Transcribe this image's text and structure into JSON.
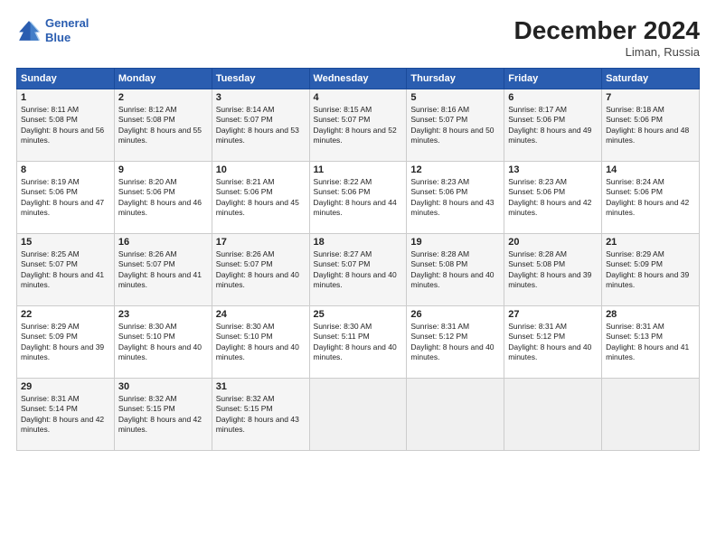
{
  "logo": {
    "line1": "General",
    "line2": "Blue"
  },
  "title": "December 2024",
  "location": "Liman, Russia",
  "days_of_week": [
    "Sunday",
    "Monday",
    "Tuesday",
    "Wednesday",
    "Thursday",
    "Friday",
    "Saturday"
  ],
  "weeks": [
    [
      {
        "day": "1",
        "sunrise": "8:11 AM",
        "sunset": "5:08 PM",
        "daylight": "8 hours and 56 minutes."
      },
      {
        "day": "2",
        "sunrise": "8:12 AM",
        "sunset": "5:08 PM",
        "daylight": "8 hours and 55 minutes."
      },
      {
        "day": "3",
        "sunrise": "8:14 AM",
        "sunset": "5:07 PM",
        "daylight": "8 hours and 53 minutes."
      },
      {
        "day": "4",
        "sunrise": "8:15 AM",
        "sunset": "5:07 PM",
        "daylight": "8 hours and 52 minutes."
      },
      {
        "day": "5",
        "sunrise": "8:16 AM",
        "sunset": "5:07 PM",
        "daylight": "8 hours and 50 minutes."
      },
      {
        "day": "6",
        "sunrise": "8:17 AM",
        "sunset": "5:06 PM",
        "daylight": "8 hours and 49 minutes."
      },
      {
        "day": "7",
        "sunrise": "8:18 AM",
        "sunset": "5:06 PM",
        "daylight": "8 hours and 48 minutes."
      }
    ],
    [
      {
        "day": "8",
        "sunrise": "8:19 AM",
        "sunset": "5:06 PM",
        "daylight": "8 hours and 47 minutes."
      },
      {
        "day": "9",
        "sunrise": "8:20 AM",
        "sunset": "5:06 PM",
        "daylight": "8 hours and 46 minutes."
      },
      {
        "day": "10",
        "sunrise": "8:21 AM",
        "sunset": "5:06 PM",
        "daylight": "8 hours and 45 minutes."
      },
      {
        "day": "11",
        "sunrise": "8:22 AM",
        "sunset": "5:06 PM",
        "daylight": "8 hours and 44 minutes."
      },
      {
        "day": "12",
        "sunrise": "8:23 AM",
        "sunset": "5:06 PM",
        "daylight": "8 hours and 43 minutes."
      },
      {
        "day": "13",
        "sunrise": "8:23 AM",
        "sunset": "5:06 PM",
        "daylight": "8 hours and 42 minutes."
      },
      {
        "day": "14",
        "sunrise": "8:24 AM",
        "sunset": "5:06 PM",
        "daylight": "8 hours and 42 minutes."
      }
    ],
    [
      {
        "day": "15",
        "sunrise": "8:25 AM",
        "sunset": "5:07 PM",
        "daylight": "8 hours and 41 minutes."
      },
      {
        "day": "16",
        "sunrise": "8:26 AM",
        "sunset": "5:07 PM",
        "daylight": "8 hours and 41 minutes."
      },
      {
        "day": "17",
        "sunrise": "8:26 AM",
        "sunset": "5:07 PM",
        "daylight": "8 hours and 40 minutes."
      },
      {
        "day": "18",
        "sunrise": "8:27 AM",
        "sunset": "5:07 PM",
        "daylight": "8 hours and 40 minutes."
      },
      {
        "day": "19",
        "sunrise": "8:28 AM",
        "sunset": "5:08 PM",
        "daylight": "8 hours and 40 minutes."
      },
      {
        "day": "20",
        "sunrise": "8:28 AM",
        "sunset": "5:08 PM",
        "daylight": "8 hours and 39 minutes."
      },
      {
        "day": "21",
        "sunrise": "8:29 AM",
        "sunset": "5:09 PM",
        "daylight": "8 hours and 39 minutes."
      }
    ],
    [
      {
        "day": "22",
        "sunrise": "8:29 AM",
        "sunset": "5:09 PM",
        "daylight": "8 hours and 39 minutes."
      },
      {
        "day": "23",
        "sunrise": "8:30 AM",
        "sunset": "5:10 PM",
        "daylight": "8 hours and 40 minutes."
      },
      {
        "day": "24",
        "sunrise": "8:30 AM",
        "sunset": "5:10 PM",
        "daylight": "8 hours and 40 minutes."
      },
      {
        "day": "25",
        "sunrise": "8:30 AM",
        "sunset": "5:11 PM",
        "daylight": "8 hours and 40 minutes."
      },
      {
        "day": "26",
        "sunrise": "8:31 AM",
        "sunset": "5:12 PM",
        "daylight": "8 hours and 40 minutes."
      },
      {
        "day": "27",
        "sunrise": "8:31 AM",
        "sunset": "5:12 PM",
        "daylight": "8 hours and 40 minutes."
      },
      {
        "day": "28",
        "sunrise": "8:31 AM",
        "sunset": "5:13 PM",
        "daylight": "8 hours and 41 minutes."
      }
    ],
    [
      {
        "day": "29",
        "sunrise": "8:31 AM",
        "sunset": "5:14 PM",
        "daylight": "8 hours and 42 minutes."
      },
      {
        "day": "30",
        "sunrise": "8:32 AM",
        "sunset": "5:15 PM",
        "daylight": "8 hours and 42 minutes."
      },
      {
        "day": "31",
        "sunrise": "8:32 AM",
        "sunset": "5:15 PM",
        "daylight": "8 hours and 43 minutes."
      },
      null,
      null,
      null,
      null
    ]
  ]
}
